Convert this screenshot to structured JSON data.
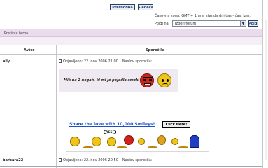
{
  "top": {
    "prev_label": "Prethodna",
    "next_label": "Sledeća",
    "timezone_text": "Časovna zona: GMT + 1 ura, standardni čas - čas. izm.",
    "jump_label": "Pojdi na:",
    "jump_selected": "Izberi forum",
    "go_label": "Pojdi"
  },
  "breadcrumb": {
    "text": "Prejšnja tema"
  },
  "table": {
    "col_author": "Avtor",
    "col_message": "Sporočilo"
  },
  "posts": [
    {
      "author": "ally",
      "meta_prefix": "Objavljeno: 22. nov 2006 21:00",
      "subject_label": "Naslov sporočila:",
      "message": "Mik na 2 nogah, ki mi je pojedla smoki je",
      "banner_text": "Share the love with 10,000 Smileys!",
      "banner_button": "Click Here!",
      "banner_bubble": "YES!"
    },
    {
      "author": "barbara22",
      "meta_prefix": "Objavljeno: 22. nov 2006 20:50",
      "subject_label": "Naslov sporočila:"
    }
  ],
  "icons": [
    "document-icon",
    "angry-smiley-icon",
    "sad-smiley-icon",
    "chevron-down-icon"
  ],
  "colors": {
    "band": "#eadcec",
    "message_bg": "#efe9f1",
    "link_blue": "#1d4fc9"
  }
}
